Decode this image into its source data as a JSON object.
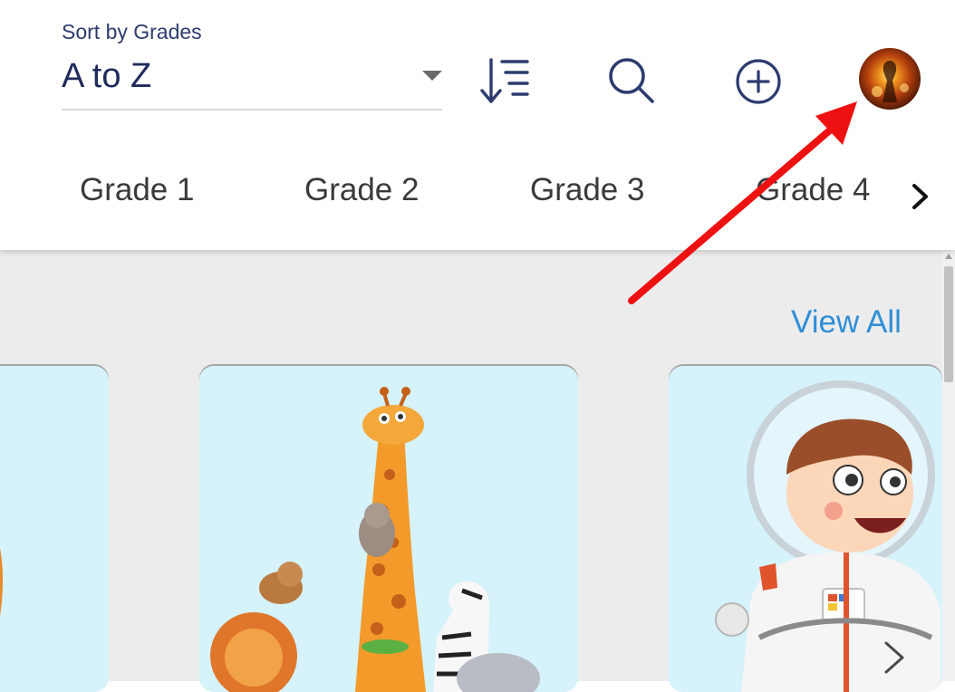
{
  "header": {
    "sort_caption": "Sort by Grades",
    "sort_value": "A to Z",
    "icons": [
      "sort-order-icon",
      "search-icon",
      "add-circle-icon"
    ],
    "accent_color": "#2d3b6e"
  },
  "tabs": [
    {
      "label": "Grade 1"
    },
    {
      "label": "Grade 2"
    },
    {
      "label": "Grade 3"
    },
    {
      "label": "Grade 4"
    }
  ],
  "content": {
    "view_all": "View All",
    "link_color": "#2f8fd6",
    "cards": [
      {
        "illustration": "lion-character-partial"
      },
      {
        "illustration": "zoo-animals-stack"
      },
      {
        "illustration": "astronaut-boy"
      }
    ]
  },
  "annotation": {
    "color": "#ee1111",
    "points_to": "profile-avatar"
  }
}
